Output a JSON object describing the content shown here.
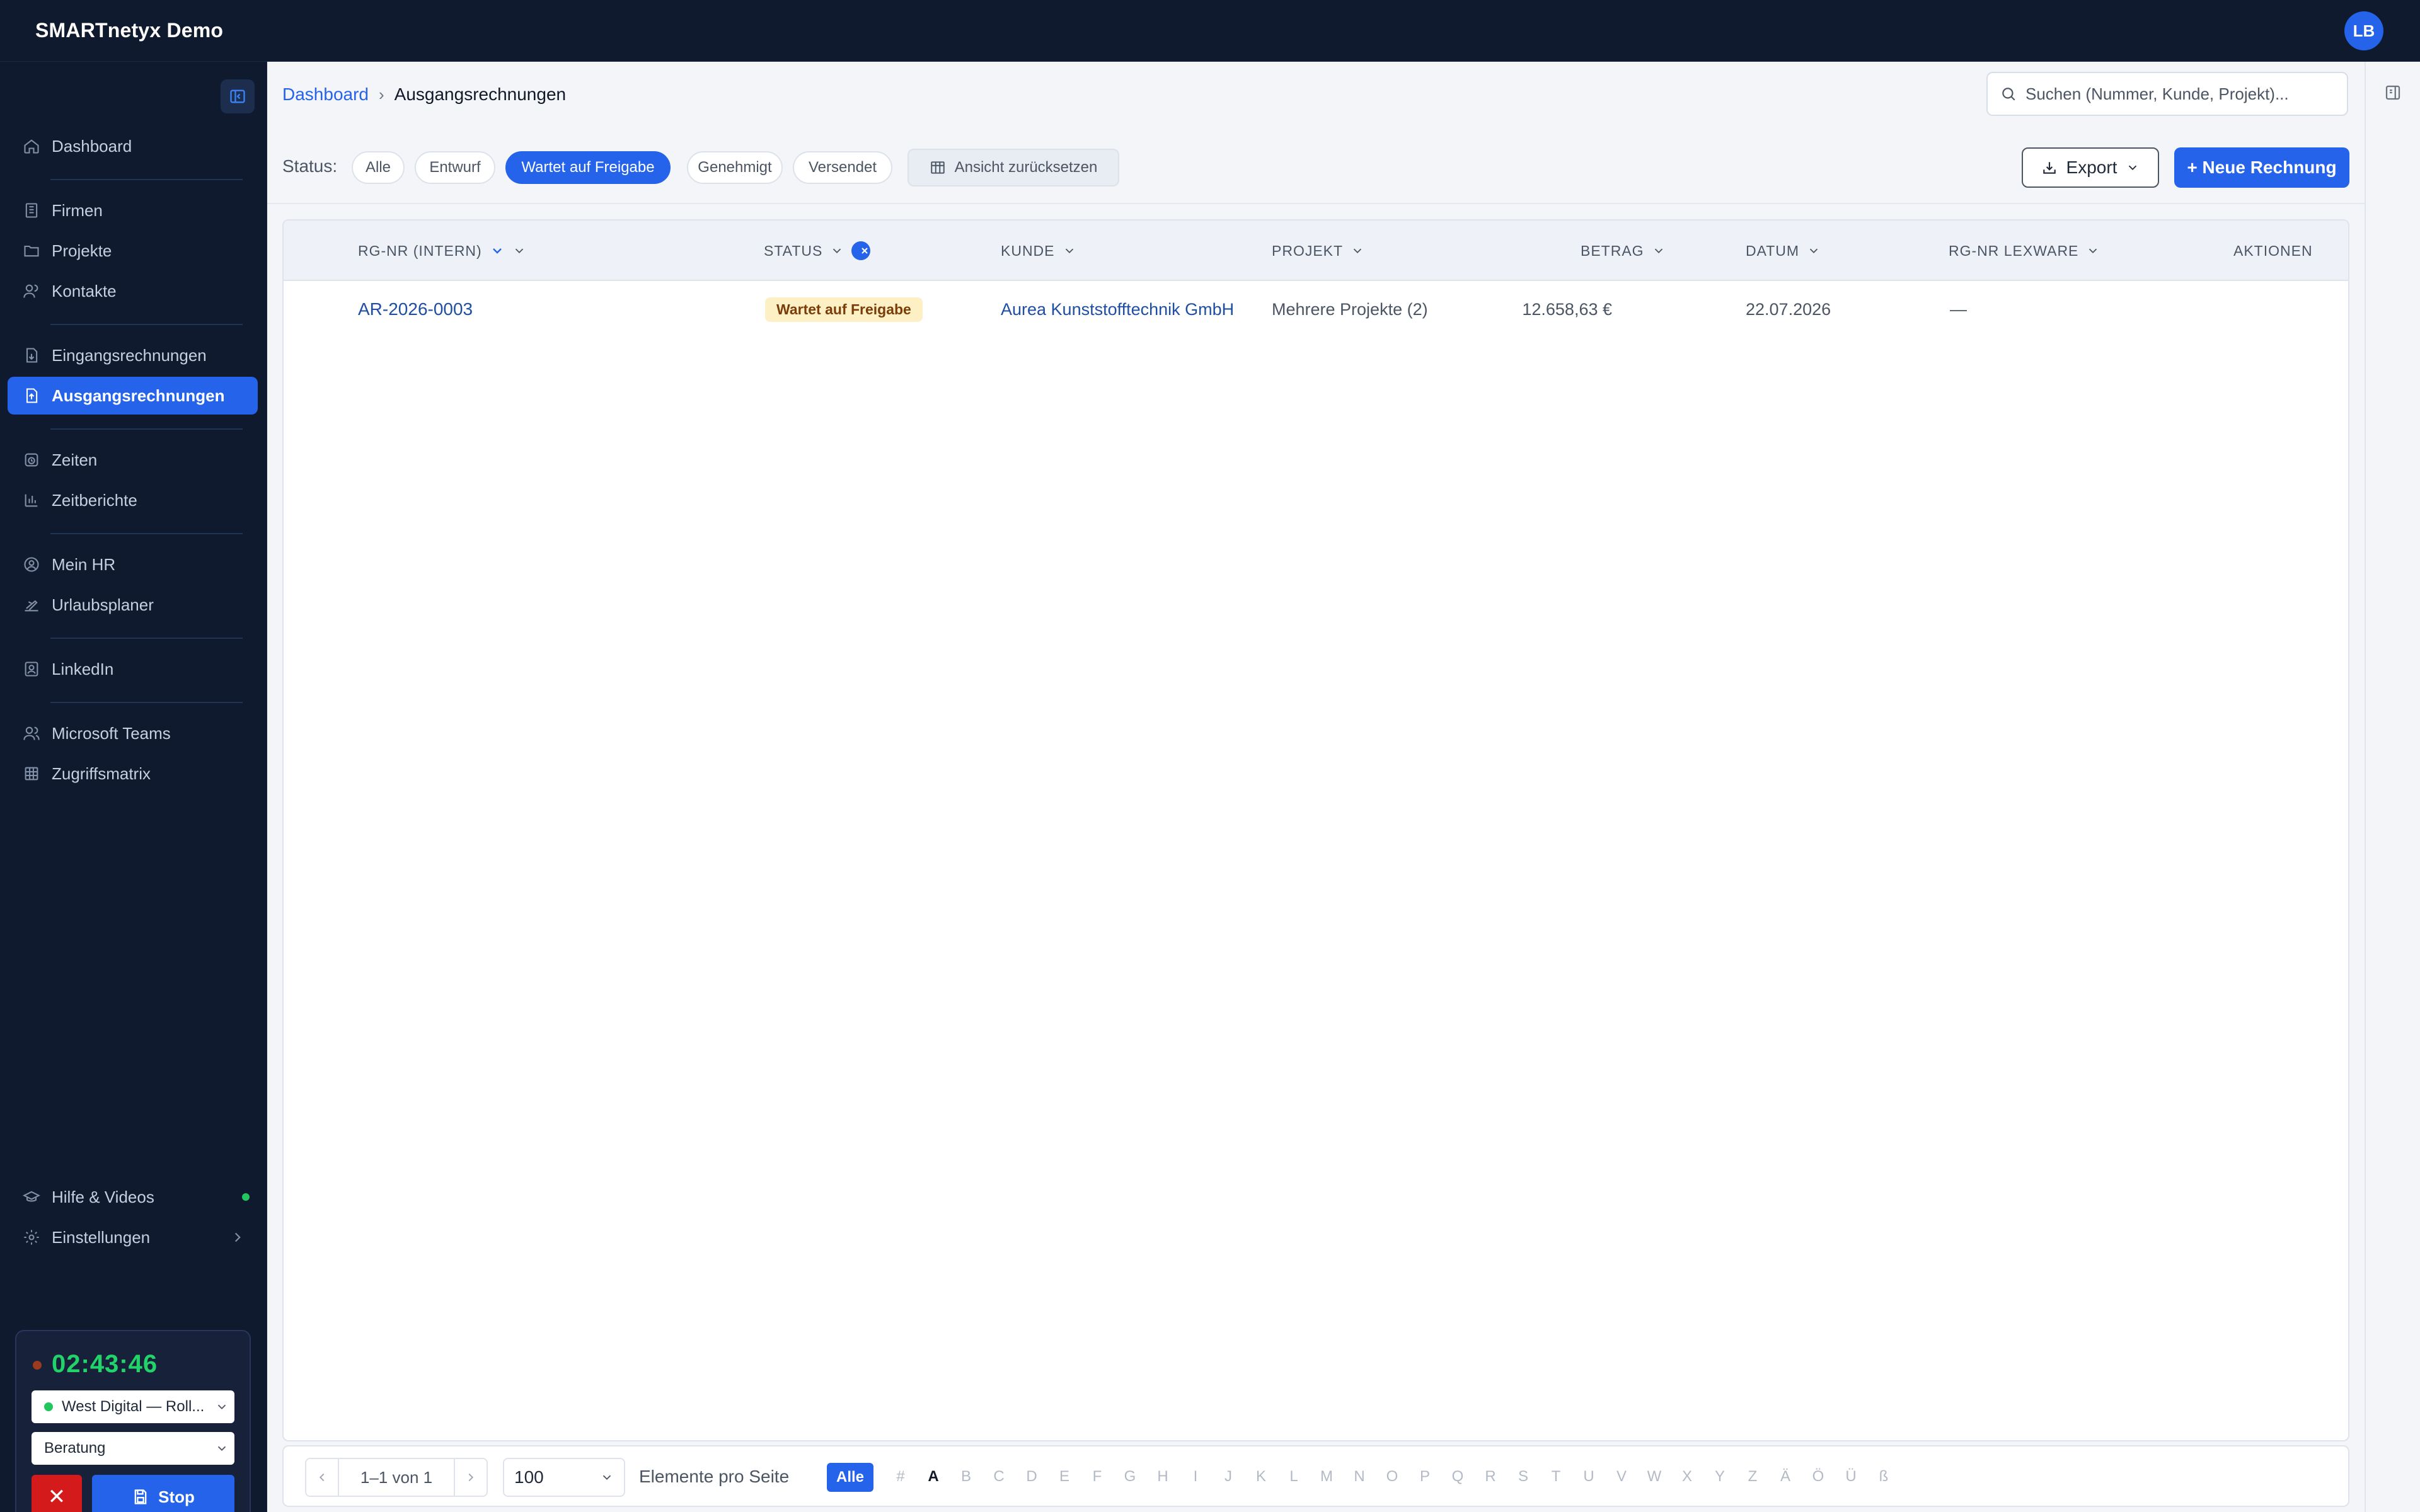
{
  "app": {
    "title": "SMARTnetyx Demo",
    "user_initials": "LB"
  },
  "sidebar": {
    "items": [
      {
        "label": "Dashboard",
        "icon": "home-icon"
      },
      {
        "label": "Firmen",
        "icon": "building-icon"
      },
      {
        "label": "Projekte",
        "icon": "folder-icon"
      },
      {
        "label": "Kontakte",
        "icon": "users-icon"
      },
      {
        "label": "Eingangsrechnungen",
        "icon": "file-in-icon"
      },
      {
        "label": "Ausgangsrechnungen",
        "icon": "file-out-icon",
        "active": true
      },
      {
        "label": "Zeiten",
        "icon": "clock-icon"
      },
      {
        "label": "Zeitberichte",
        "icon": "bar-chart-icon"
      },
      {
        "label": "Mein HR",
        "icon": "user-circle-icon"
      },
      {
        "label": "Urlaubsplaner",
        "icon": "plane-icon"
      },
      {
        "label": "LinkedIn",
        "icon": "contact-card-icon"
      },
      {
        "label": "Microsoft Teams",
        "icon": "team-icon"
      },
      {
        "label": "Zugriffsmatrix",
        "icon": "grid-icon"
      }
    ],
    "help_label": "Hilfe & Videos",
    "settings_label": "Einstellungen"
  },
  "timer": {
    "value": "02:43:46",
    "project": "West Digital — Roll...",
    "activity": "Beratung",
    "cancel_label": "✕",
    "stop_label": "Stop"
  },
  "breadcrumb": {
    "home": "Dashboard",
    "current": "Ausgangsrechnungen"
  },
  "search": {
    "placeholder": "Suchen (Nummer, Kunde, Projekt)..."
  },
  "filters": {
    "label": "Status:",
    "chips": [
      "Alle",
      "Entwurf",
      "Wartet auf Freigabe",
      "Genehmigt",
      "Versendet"
    ],
    "active_chip": "Wartet auf Freigabe",
    "reset_label": "Ansicht zurücksetzen"
  },
  "actions": {
    "export_label": "Export",
    "new_label": "+ Neue Rechnung"
  },
  "table": {
    "columns": [
      "RG-NR (INTERN)",
      "STATUS",
      "KUNDE",
      "PROJEKT",
      "BETRAG",
      "DATUM",
      "RG-NR LEXWARE",
      "AKTIONEN"
    ],
    "rows": [
      {
        "number": "AR-2026-0003",
        "status": "Wartet auf Freigabe",
        "customer": "Aurea Kunststofftechnik GmbH",
        "project": "Mehrere Projekte (2)",
        "amount": "12.658,63 €",
        "date": "22.07.2026",
        "lexware": "—"
      }
    ]
  },
  "pagination": {
    "range": "1–1 von 1",
    "per_page": "100",
    "per_page_label": "Elemente pro Seite",
    "all_label": "Alle",
    "letters": [
      "#",
      "A",
      "B",
      "C",
      "D",
      "E",
      "F",
      "G",
      "H",
      "I",
      "J",
      "K",
      "L",
      "M",
      "N",
      "O",
      "P",
      "Q",
      "R",
      "S",
      "T",
      "U",
      "V",
      "W",
      "X",
      "Y",
      "Z",
      "Ä",
      "Ö",
      "Ü",
      "ß"
    ],
    "enabled_letter": "A"
  },
  "colors": {
    "accent": "#2563eb",
    "sidebar_bg": "#0f1a2e",
    "timer_green": "#22d36a",
    "badge_bg": "#fdf0c4"
  }
}
